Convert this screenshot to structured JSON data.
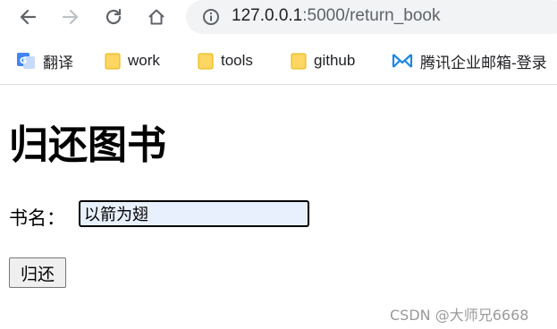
{
  "browser": {
    "url": {
      "host": "127.0.0.1",
      "rest": ":5000/return_book"
    },
    "bookmarks": [
      {
        "label": "翻译",
        "icon": "translate-icon"
      },
      {
        "label": "work",
        "icon": "folder-icon"
      },
      {
        "label": "tools",
        "icon": "folder-icon"
      },
      {
        "label": "github",
        "icon": "folder-icon"
      },
      {
        "label": "腾讯企业邮箱-登录",
        "icon": "tencent-mail-icon"
      }
    ]
  },
  "page": {
    "title": "归还图书",
    "form": {
      "book_label": "书名：",
      "book_value": "以箭为翅",
      "submit_label": "归还"
    }
  },
  "watermark": "CSDN @大师兄6668",
  "colors": {
    "folder": "#fdd663",
    "tencent_icon": "#1e88e5",
    "input_bg": "#e8f0fe"
  }
}
